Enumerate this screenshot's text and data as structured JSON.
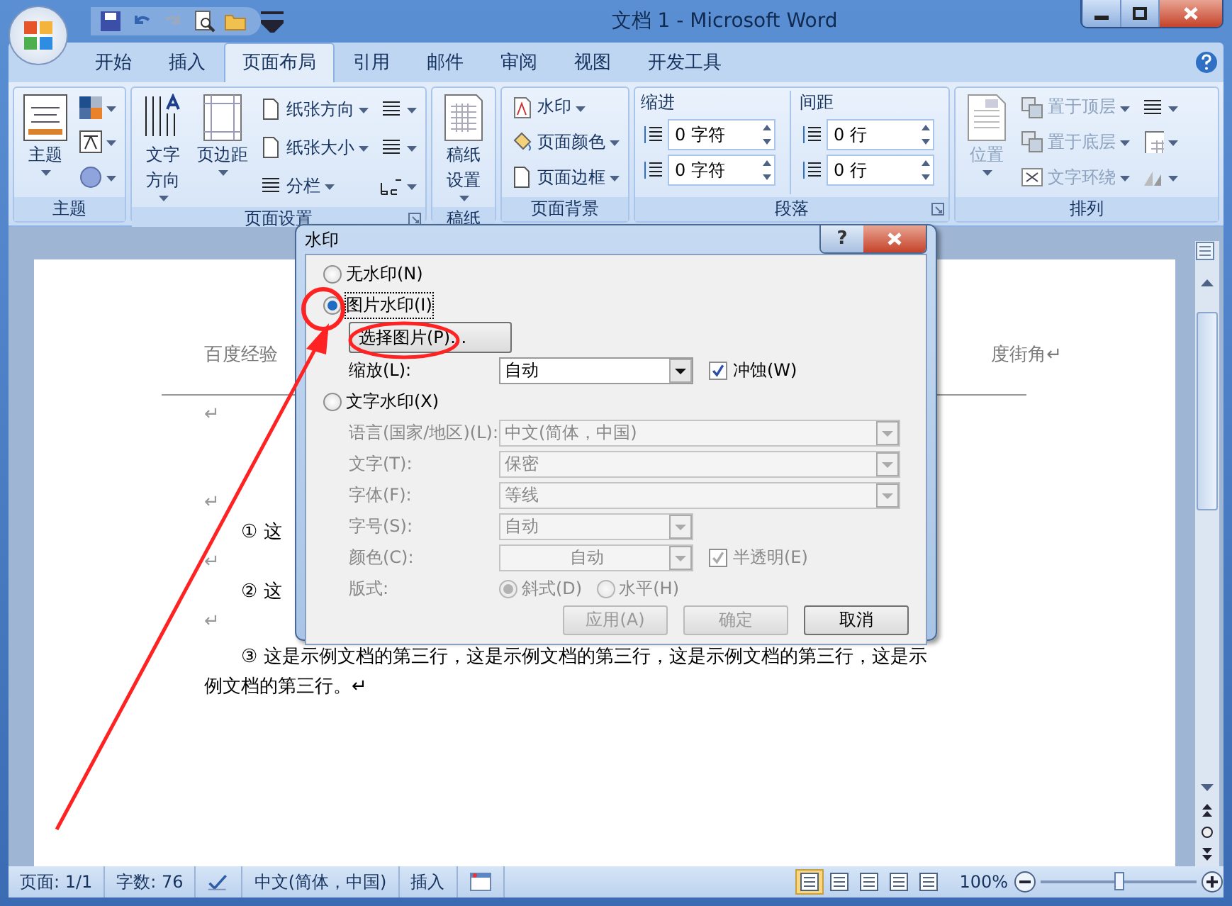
{
  "window": {
    "title": "文档 1 - Microsoft Word"
  },
  "tabs": [
    {
      "label": "开始",
      "selected": false
    },
    {
      "label": "插入",
      "selected": false
    },
    {
      "label": "页面布局",
      "selected": true
    },
    {
      "label": "引用",
      "selected": false
    },
    {
      "label": "邮件",
      "selected": false
    },
    {
      "label": "审阅",
      "selected": false
    },
    {
      "label": "视图",
      "selected": false
    },
    {
      "label": "开发工具",
      "selected": false
    }
  ],
  "ribbon_groups": [
    {
      "label": "主题",
      "items": [
        {
          "kind": "large",
          "label": "主题"
        },
        {
          "kind": "column",
          "items": [
            {
              "kind": "icon"
            },
            {
              "kind": "icon"
            },
            {
              "kind": "icon"
            }
          ]
        }
      ]
    },
    {
      "label": "页面设置",
      "launcher": true,
      "items": [
        {
          "kind": "large",
          "label": "文字方向"
        },
        {
          "kind": "large",
          "label": "页边距"
        },
        {
          "kind": "column",
          "items": [
            {
              "kind": "small",
              "label": "纸张方向"
            },
            {
              "kind": "small",
              "label": "纸张大小"
            },
            {
              "kind": "small",
              "label": "分栏"
            }
          ]
        },
        {
          "kind": "column",
          "items": [
            {
              "kind": "icon"
            },
            {
              "kind": "icon"
            },
            {
              "kind": "icon"
            }
          ]
        }
      ]
    },
    {
      "label": "稿纸",
      "items": [
        {
          "kind": "large",
          "label": "稿纸设置"
        }
      ]
    },
    {
      "label": "页面背景",
      "items": [
        {
          "kind": "column",
          "items": [
            {
              "kind": "small",
              "label": "水印"
            },
            {
              "kind": "small",
              "label": "页面颜色"
            },
            {
              "kind": "small",
              "label": "页面边框"
            }
          ]
        }
      ]
    },
    {
      "label": "段落",
      "launcher": true,
      "items": [
        {
          "kind": "spinners",
          "label": "缩进",
          "fields": [
            "0 字符",
            "0 字符"
          ]
        },
        {
          "kind": "spinners",
          "label": "间距",
          "fields": [
            "0 行",
            "0 行"
          ]
        }
      ]
    },
    {
      "label": "排列",
      "items": [
        {
          "kind": "large",
          "label": "位置",
          "disabled": true
        },
        {
          "kind": "column",
          "items": [
            {
              "kind": "small",
              "label": "置于顶层",
              "disabled": true
            },
            {
              "kind": "small",
              "label": "置于底层",
              "disabled": true
            },
            {
              "kind": "small",
              "label": "文字环绕",
              "disabled": true
            }
          ]
        },
        {
          "kind": "column",
          "items": [
            {
              "kind": "icon"
            },
            {
              "kind": "icon"
            },
            {
              "kind": "icon",
              "disabled": true
            }
          ]
        }
      ]
    }
  ],
  "document": {
    "header_left": "百度经验",
    "header_right": "度街角↵",
    "paragraphs": [
      "↵",
      "↵",
      "① 这",
      "↵",
      "② 这",
      "↵",
      "③ 这是示例文档的第三行，这是示例文档的第三行，这是示例文档的第三行，这是示例文档的第三行。↵"
    ]
  },
  "dialog": {
    "title": "水印",
    "help": "?",
    "options": [
      {
        "kind": "radio",
        "label": "无水印(N)",
        "selected": false
      },
      {
        "kind": "radio",
        "label": "图片水印(I)",
        "selected": true
      },
      {
        "kind": "button",
        "label": "选择图片(P)..."
      },
      {
        "kind": "combo",
        "label": "缩放(L):",
        "value": "自动",
        "check": {
          "label": "冲蚀(W)",
          "checked": true
        }
      },
      {
        "kind": "radio",
        "label": "文字水印(X)",
        "selected": false
      },
      {
        "kind": "wide_combo",
        "label": "语言(国家/地区)(L):",
        "value": "中文(简体，中国)",
        "disabled": true
      },
      {
        "kind": "wide_combo",
        "label": "文字(T):",
        "value": "保密",
        "disabled": true
      },
      {
        "kind": "wide_combo",
        "label": "字体(F):",
        "value": "等线",
        "disabled": true
      },
      {
        "kind": "combo",
        "label": "字号(S):",
        "value": "自动",
        "disabled": true
      },
      {
        "kind": "color_combo",
        "label": "颜色(C):",
        "value": "自动",
        "disabled": true,
        "check": {
          "label": "半透明(E)",
          "checked": true,
          "disabled": true
        }
      },
      {
        "kind": "layout",
        "label": "版式:",
        "choices": [
          {
            "label": "斜式(D)",
            "selected": true
          },
          {
            "label": "水平(H)",
            "selected": false
          }
        ]
      }
    ],
    "buttons": [
      {
        "label": "应用(A)",
        "disabled": true
      },
      {
        "label": "确定",
        "disabled": true
      },
      {
        "label": "取消",
        "disabled": false
      }
    ]
  },
  "status_bar": {
    "left": [
      "页面: 1/1",
      "字数: 76",
      "中文(简体，中国)",
      "插入"
    ],
    "views": [
      {
        "selected": true
      },
      {
        "selected": false
      },
      {
        "selected": false
      },
      {
        "selected": false
      },
      {
        "selected": false
      }
    ],
    "zoom": "100%",
    "zoom_slider": {
      "level": 0.5
    }
  }
}
